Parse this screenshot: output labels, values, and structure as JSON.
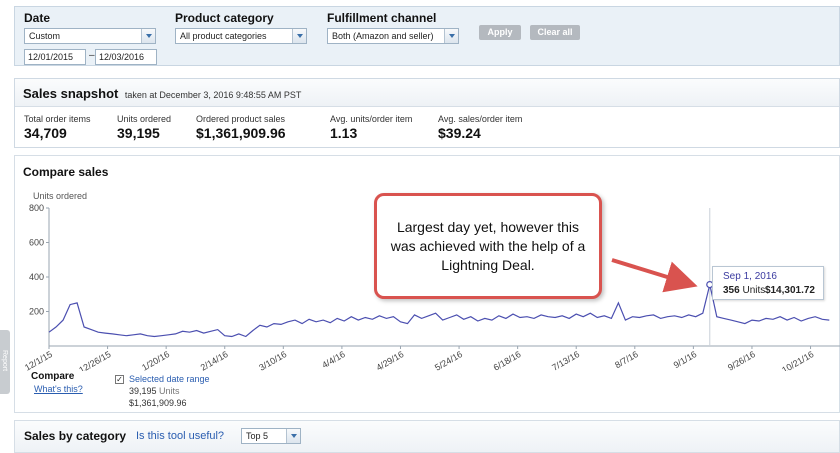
{
  "filters": {
    "date": {
      "label": "Date",
      "preset": "Custom",
      "start": "12/01/2015",
      "end": "12/03/2016",
      "separator": "–"
    },
    "product_category": {
      "label": "Product category",
      "value": "All product categories"
    },
    "fulfillment_channel": {
      "label": "Fulfillment channel",
      "value": "Both (Amazon and seller)"
    },
    "apply_label": "Apply",
    "clear_label": "Clear all"
  },
  "snapshot": {
    "title": "Sales snapshot",
    "taken": "taken at December 3, 2016 9:48:55 AM PST",
    "metrics": [
      {
        "label": "Total order items",
        "value": "34,709"
      },
      {
        "label": "Units ordered",
        "value": "39,195"
      },
      {
        "label": "Ordered product sales",
        "value": "$1,361,909.96"
      },
      {
        "label": "Avg. units/order item",
        "value": "1.13"
      },
      {
        "label": "Avg. sales/order item",
        "value": "$39.24"
      }
    ]
  },
  "compare": {
    "title": "Compare sales",
    "legend_title": "Compare",
    "whats_this": "What's this?",
    "series_label": "Selected date range",
    "series_checked": "✓",
    "series_units": "39,195",
    "series_units_word": "Units",
    "series_sales": "$1,361,909.96"
  },
  "tooltip": {
    "date": "Sep 1, 2016",
    "units": "356",
    "units_word": "Units",
    "sales": "$14,301.72"
  },
  "callout": {
    "text": "Largest day yet, however this was achieved with the help of a Lightning Deal."
  },
  "category": {
    "title": "Sales by category",
    "link": "Is this tool useful?",
    "top_select": "Top 5"
  },
  "report_tab": "Report",
  "colors": {
    "line": "#4b4fb0",
    "callout_border": "#d9534f",
    "link": "#2a5db0"
  },
  "chart_data": {
    "type": "line",
    "ylabel": "Units ordered",
    "ylim": [
      0,
      800
    ],
    "y_ticks": [
      200,
      400,
      600,
      800
    ],
    "x_tick_labels": [
      "12/1/15",
      "12/26/15",
      "1/20/16",
      "2/14/16",
      "3/10/16",
      "4/4/16",
      "4/29/16",
      "5/24/16",
      "6/18/16",
      "7/13/16",
      "8/7/16",
      "9/1/16",
      "9/26/16",
      "10/21/16"
    ],
    "x_tick_day_index": [
      0,
      25,
      50,
      75,
      100,
      125,
      150,
      175,
      200,
      225,
      250,
      275,
      300,
      325
    ],
    "grid": false,
    "series": [
      {
        "name": "Selected date range",
        "day_step": 3,
        "values": [
          80,
          110,
          150,
          240,
          250,
          110,
          95,
          80,
          75,
          70,
          65,
          60,
          65,
          70,
          60,
          55,
          60,
          65,
          70,
          85,
          80,
          90,
          75,
          85,
          95,
          60,
          55,
          70,
          55,
          90,
          120,
          110,
          130,
          125,
          140,
          150,
          130,
          155,
          140,
          150,
          135,
          160,
          145,
          170,
          150,
          165,
          155,
          175,
          160,
          170,
          140,
          130,
          180,
          160,
          175,
          190,
          150,
          165,
          180,
          155,
          170,
          145,
          160,
          150,
          175,
          160,
          185,
          165,
          170,
          160,
          180,
          170,
          165,
          175,
          160,
          185,
          170,
          190,
          165,
          175,
          160,
          250,
          150,
          170,
          165,
          175,
          180,
          160,
          170,
          175,
          165,
          180,
          170,
          190,
          356,
          170,
          160,
          150,
          140,
          130,
          150,
          145,
          160,
          155,
          170,
          150,
          165,
          145,
          160,
          170,
          155,
          150
        ]
      }
    ],
    "highlight": {
      "x": "9/1/16",
      "y": 356
    }
  }
}
